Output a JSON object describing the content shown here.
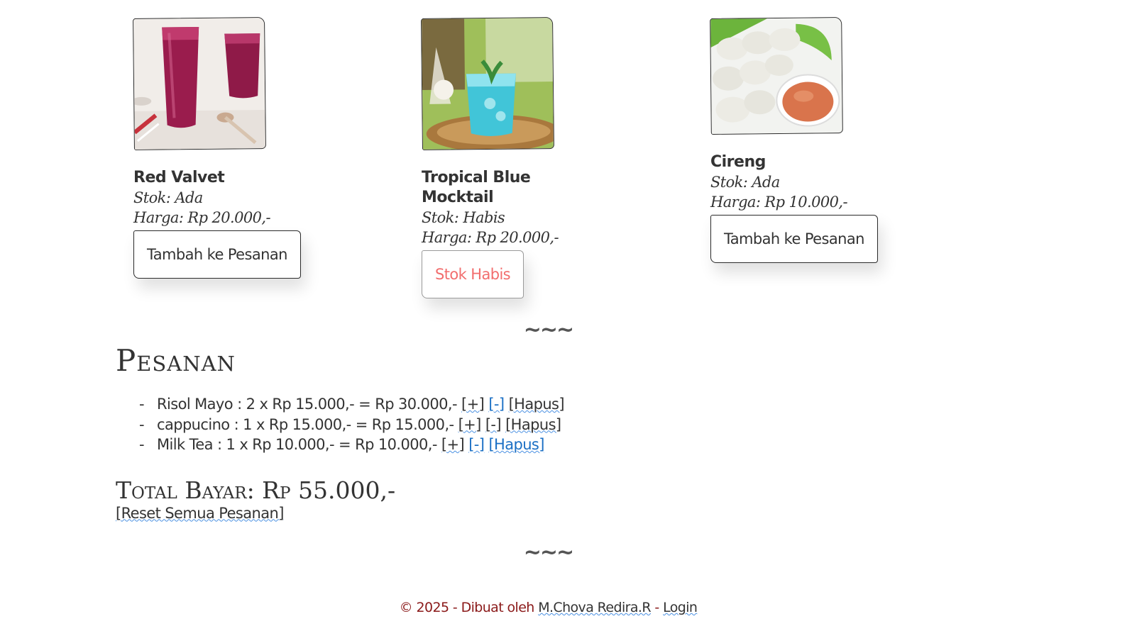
{
  "products": [
    {
      "name": "Red Valvet",
      "stock": "Stok: Ada",
      "price": "Harga: Rp 20.000,-",
      "button_label": "Tambah ke Pesanan",
      "image_icon": "red-velvet-drink-photo"
    },
    {
      "name": "Tropical Blue Mocktail",
      "stock": "Stok: Habis",
      "price": "Harga: Rp 20.000,-",
      "button_label": "Stok Habis",
      "image_icon": "blue-mocktail-photo"
    },
    {
      "name": "Cireng",
      "stock": "Stok: Ada",
      "price": "Harga: Rp 10.000,-",
      "button_label": "Tambah ke Pesanan",
      "image_icon": "cireng-with-sauce-photo"
    }
  ],
  "divider_text": "~~~",
  "order": {
    "title": "Pesanan",
    "items": [
      {
        "text": "Risol Mayo : 2 x Rp 15.000,- = Rp 30.000,-",
        "plus": "[+]",
        "minus": "[-]",
        "delete": "[Hapus]"
      },
      {
        "text": "cappucino : 1 x Rp 15.000,- = Rp 15.000,-",
        "plus": "[+]",
        "minus": "[-]",
        "delete": "[Hapus]"
      },
      {
        "text": "Milk Tea : 1 x Rp 10.000,- = Rp 10.000,-",
        "plus": "[+]",
        "minus": "[-]",
        "delete": "[Hapus]"
      }
    ],
    "total": "Total Bayar: Rp 55.000,-",
    "reset": "[Reset Semua Pesanan]"
  },
  "footer": {
    "prefix": "© 2025 - Dibuat oleh ",
    "author": "M.Chova Redira.R",
    "separator": " - ",
    "login": "Login"
  },
  "colors": {
    "text": "#333333",
    "out_of_stock": "#f26d6d",
    "link_blue": "#1a6fc4",
    "footer_text": "#8b1a1a"
  }
}
